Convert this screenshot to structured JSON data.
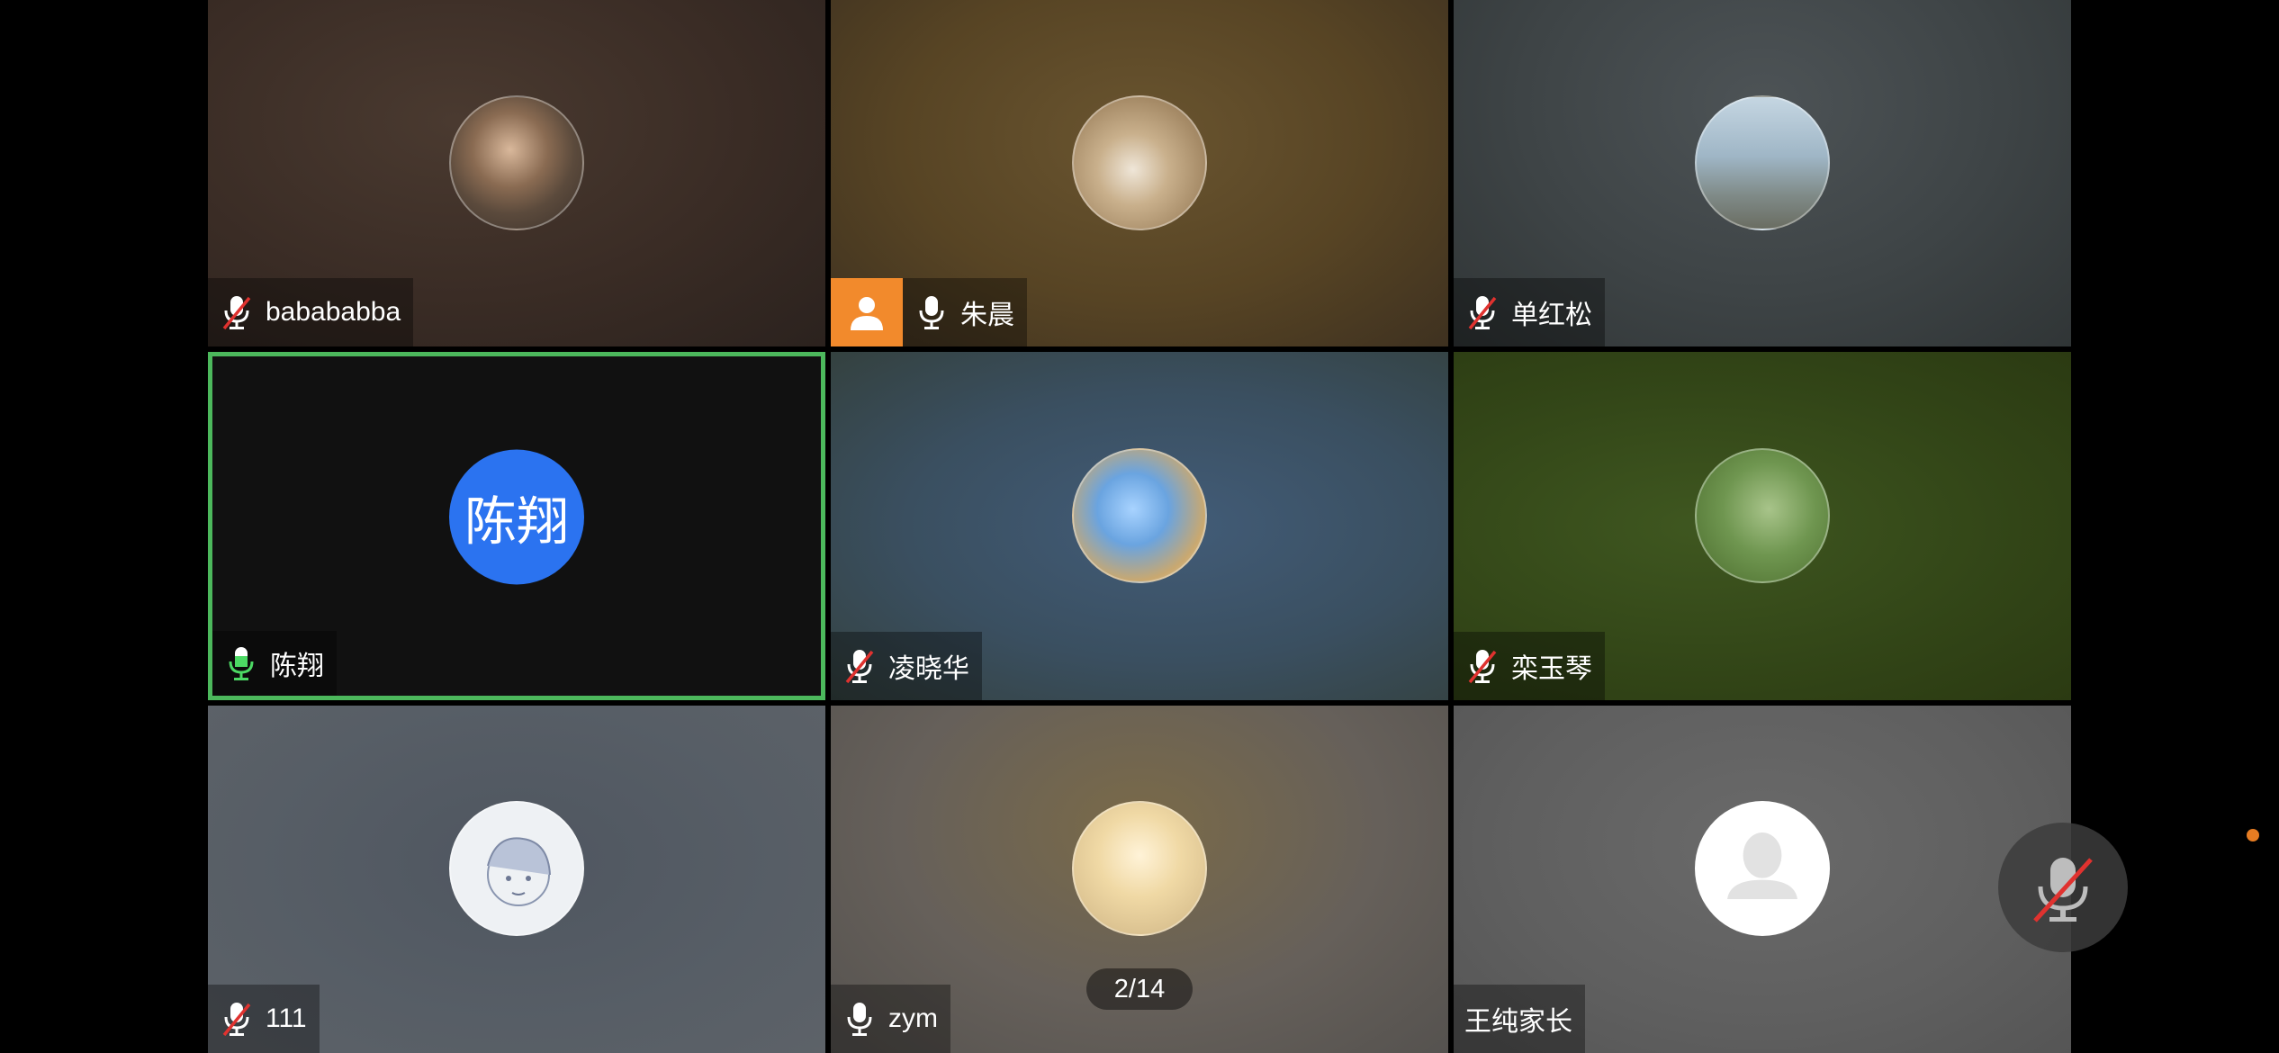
{
  "participants": [
    {
      "name": "babababba",
      "mic": "muted"
    },
    {
      "name": "朱晨",
      "mic": "on"
    },
    {
      "name": "单红松",
      "mic": "muted"
    },
    {
      "name": "陈翔",
      "mic": "speaking",
      "avatar_text": "陈翔"
    },
    {
      "name": "凌晓华",
      "mic": "muted"
    },
    {
      "name": "栾玉琴",
      "mic": "muted"
    },
    {
      "name": "111",
      "mic": "muted"
    },
    {
      "name": "zym",
      "mic": "on"
    },
    {
      "name": "王纯家长",
      "mic": "none"
    }
  ],
  "pager": {
    "text": "2/14"
  },
  "colors": {
    "active_speaker_border": "#4cb85c",
    "initials_avatar": "#2b73f0",
    "host_badge": "#f28a2c",
    "mute_slash": "#e0322f",
    "notification_dot": "#e67c22"
  },
  "icons": [
    "mic-muted-icon",
    "mic-icon",
    "person-icon",
    "mic-muted-large-icon"
  ]
}
